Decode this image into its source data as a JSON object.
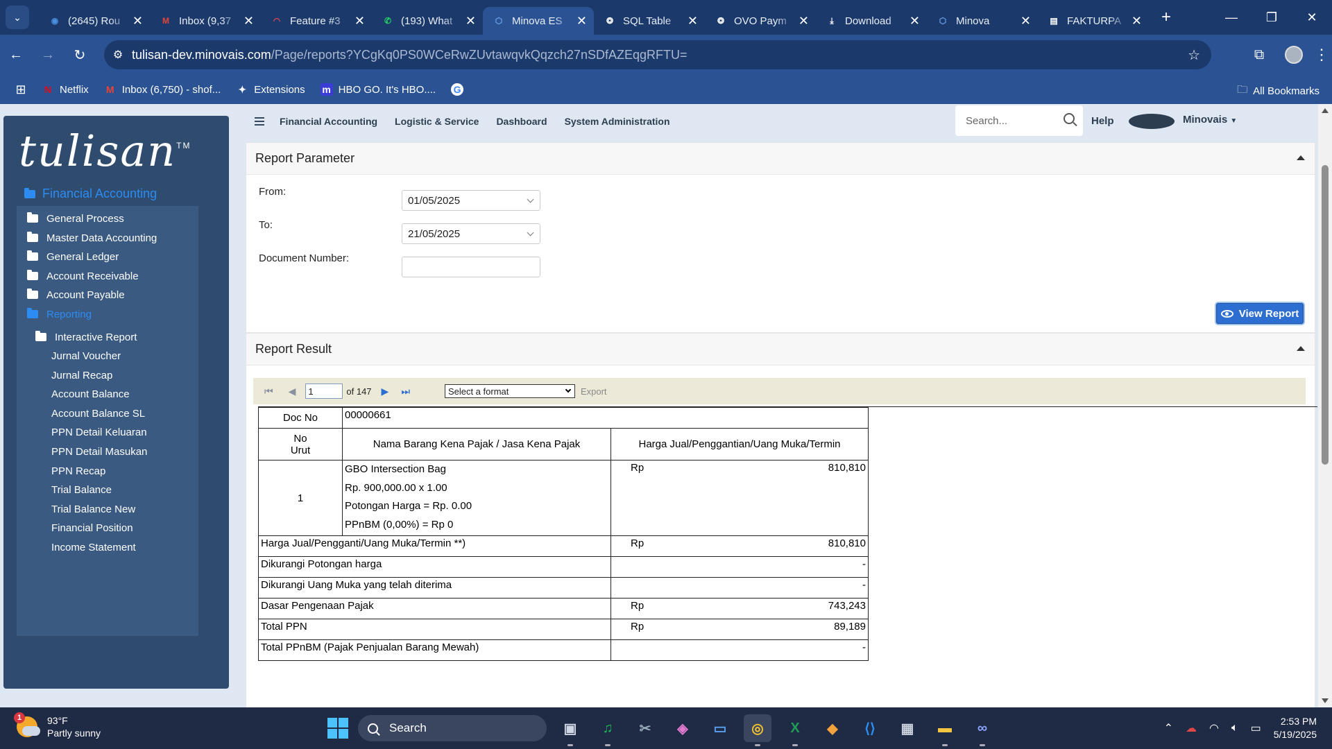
{
  "browser": {
    "tabs": [
      {
        "title": "(2645) Rou",
        "icon": "globe-icon",
        "color": "#4a90e2",
        "glyph": "◉"
      },
      {
        "title": "Inbox (9,37",
        "icon": "gmail-icon",
        "color": "#ea4335",
        "glyph": "M"
      },
      {
        "title": "Feature #3",
        "icon": "feature-icon",
        "color": "#e0464e",
        "glyph": "◠"
      },
      {
        "title": "(193) What",
        "icon": "whatsapp-icon",
        "color": "#25d366",
        "glyph": "✆"
      },
      {
        "title": "Minova ES",
        "icon": "minova-icon",
        "color": "#6aa0e8",
        "glyph": "⬡",
        "active": true
      },
      {
        "title": "SQL Table",
        "icon": "openai-icon",
        "color": "#ffffff",
        "glyph": "❂"
      },
      {
        "title": "OVO Paym",
        "icon": "openai-icon",
        "color": "#ffffff",
        "glyph": "❂"
      },
      {
        "title": "Download",
        "icon": "download-icon",
        "color": "#ffffff",
        "glyph": "⤓"
      },
      {
        "title": "Minova",
        "icon": "minova-icon",
        "color": "#6aa0e8",
        "glyph": "⬡"
      },
      {
        "title": "FAKTURPA",
        "icon": "report-icon",
        "color": "#ffffff",
        "glyph": "▤"
      }
    ],
    "url_host": "tulisan-dev.minovais.com",
    "url_path": "/Page/reports?YCgKq0PS0WCeRwZUvtawqvkQqzch27nSDfAZEqgRFTU=",
    "bookmarks": [
      {
        "label": "Netflix",
        "icon": "netflix-icon",
        "color": "#e50914",
        "glyph": "N"
      },
      {
        "label": "Inbox (6,750) - shof...",
        "icon": "gmail-icon",
        "color": "#ea4335",
        "glyph": "M"
      },
      {
        "label": "Extensions",
        "icon": "puzzle-icon",
        "color": "#ffffff",
        "glyph": "✦"
      },
      {
        "label": "HBO GO. It's HBO....",
        "icon": "hbo-icon",
        "color": "#3b3bd6",
        "glyph": "m"
      },
      {
        "label": "",
        "icon": "google-icon",
        "color": "#ffffff",
        "glyph": "G"
      }
    ],
    "all_bookmarks": "All Bookmarks"
  },
  "sidebar": {
    "logo": "tulisan",
    "logo_tm": "TM",
    "section": "Financial Accounting",
    "items": [
      {
        "label": "General Process",
        "folder": true,
        "level": 0
      },
      {
        "label": "Master Data Accounting",
        "folder": true,
        "level": 0
      },
      {
        "label": "General Ledger",
        "folder": true,
        "level": 0
      },
      {
        "label": "Account Receivable",
        "folder": true,
        "level": 0
      },
      {
        "label": "Account Payable",
        "folder": true,
        "level": 0
      },
      {
        "label": "Reporting",
        "folder": true,
        "level": 0,
        "active": true
      },
      {
        "label": "Interactive Report",
        "folder": true,
        "level": 1
      },
      {
        "label": "Jurnal Voucher",
        "folder": false,
        "level": 1
      },
      {
        "label": "Jurnal Recap",
        "folder": false,
        "level": 1
      },
      {
        "label": "Account Balance",
        "folder": false,
        "level": 1
      },
      {
        "label": "Account Balance SL",
        "folder": false,
        "level": 1
      },
      {
        "label": "PPN Detail Keluaran",
        "folder": false,
        "level": 1
      },
      {
        "label": "PPN Detail Masukan",
        "folder": false,
        "level": 1
      },
      {
        "label": "PPN Recap",
        "folder": false,
        "level": 1
      },
      {
        "label": "Trial Balance",
        "folder": false,
        "level": 1
      },
      {
        "label": "Trial Balance New",
        "folder": false,
        "level": 1
      },
      {
        "label": "Financial Position",
        "folder": false,
        "level": 1
      },
      {
        "label": "Income Statement",
        "folder": false,
        "level": 1
      }
    ]
  },
  "topnav": {
    "items": [
      "Financial Accounting",
      "Logistic & Service",
      "Dashboard",
      "System Administration"
    ],
    "search_placeholder": "Search...",
    "help": "Help",
    "user": "Minovais"
  },
  "params": {
    "title": "Report Parameter",
    "from_label": "From:",
    "from_value": "01/05/2025",
    "to_label": "To:",
    "to_value": "21/05/2025",
    "docnum_label": "Document Number:",
    "docnum_value": "",
    "view_button": "View Report"
  },
  "result": {
    "title": "Report Result",
    "page_current": "1",
    "page_of": "of 147",
    "format_placeholder": "Select a format",
    "export": "Export",
    "doc_no_label": "Doc No",
    "doc_no": "00000661",
    "col_no": "No\nUrut",
    "col_name": "Nama Barang Kena Pajak / Jasa Kena Pajak",
    "col_price": "Harga Jual/Penggantian/Uang Muka/Termin",
    "item": {
      "no": "1",
      "lines": [
        "GBO Intersection Bag",
        "Rp. 900,000.00 x 1.00",
        "Potongan Harga = Rp.  0.00",
        "PPnBM (0,00%) = Rp 0"
      ],
      "currency": "Rp",
      "amount": "810,810"
    },
    "summary": [
      {
        "label": "Harga Jual/Pengganti/Uang Muka/Termin **)",
        "currency": "Rp",
        "amount": "810,810"
      },
      {
        "label": "Dikurangi Potongan harga",
        "currency": "",
        "amount": "-"
      },
      {
        "label": "Dikurangi Uang Muka yang telah diterima",
        "currency": "",
        "amount": "-"
      },
      {
        "label": "Dasar Pengenaan Pajak",
        "currency": "Rp",
        "amount": "743,243"
      },
      {
        "label": "Total PPN",
        "currency": "Rp",
        "amount": "89,189"
      },
      {
        "label": "Total PPnBM (Pajak Penjualan Barang Mewah)",
        "currency": "",
        "amount": "-"
      }
    ]
  },
  "taskbar": {
    "weather_temp": "93°F",
    "weather_desc": "Partly sunny",
    "weather_badge": "1",
    "search": "Search",
    "time": "2:53 PM",
    "date": "5/19/2025",
    "apps": [
      {
        "icon": "task-view-icon",
        "glyph": "▣",
        "color": "#cfd6e4"
      },
      {
        "icon": "spotify-icon",
        "glyph": "♫",
        "color": "#1db954"
      },
      {
        "icon": "snipping-tool-icon",
        "glyph": "✂",
        "color": "#9ab"
      },
      {
        "icon": "copilot-icon",
        "glyph": "◈",
        "color": "#e07ad0"
      },
      {
        "icon": "remote-desktop-icon",
        "glyph": "▭",
        "color": "#5aa0f0"
      },
      {
        "icon": "chrome-icon",
        "glyph": "◎",
        "color": "#f2c230",
        "active": true
      },
      {
        "icon": "excel-icon",
        "glyph": "X",
        "color": "#1f9d55"
      },
      {
        "icon": "sql-tool-icon",
        "glyph": "◆",
        "color": "#f2a23a"
      },
      {
        "icon": "vscode-icon",
        "glyph": "⟨⟩",
        "color": "#2b8ef0"
      },
      {
        "icon": "tool-icon",
        "glyph": "▦",
        "color": "#c8d0dc"
      },
      {
        "icon": "file-explorer-icon",
        "glyph": "▬",
        "color": "#f5c542"
      },
      {
        "icon": "link-icon",
        "glyph": "∞",
        "color": "#8aa4ff"
      }
    ]
  }
}
